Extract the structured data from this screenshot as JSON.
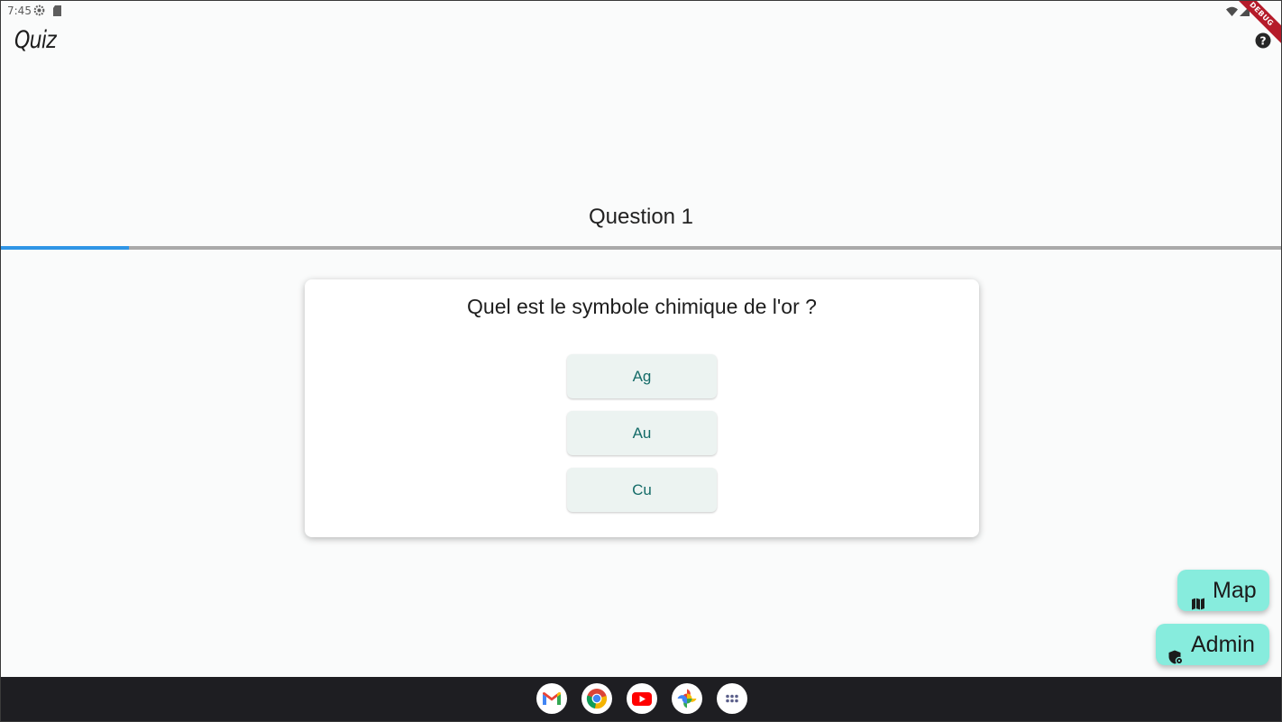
{
  "status_bar": {
    "time": "7:45",
    "left_icons": [
      "settings-gear-icon",
      "sd-card-icon"
    ],
    "right_icons": [
      "wifi-icon",
      "signal-icon"
    ],
    "debug_label": "DEBUG"
  },
  "app_bar": {
    "title": "Quiz",
    "help_icon": "help-circle-icon"
  },
  "quiz": {
    "question_label": "Question 1",
    "progress": 0.1,
    "question_text": "Quel est le symbole chimique de l'or ?",
    "answers": [
      "Ag",
      "Au",
      "Cu"
    ]
  },
  "fabs": {
    "map_label": "Map",
    "map_icon": "map-icon",
    "admin_label": "Admin",
    "admin_icon": "admin-shield-icon"
  },
  "taskbar": {
    "apps": [
      "gmail-icon",
      "chrome-icon",
      "youtube-icon",
      "photos-icon",
      "app-drawer-icon"
    ]
  },
  "colors": {
    "accent_progress": "#2f95e6",
    "fab_background": "#87ecdd",
    "answer_text": "#146b68",
    "answer_background": "#ecf3f1",
    "debug_banner": "#b51b2a"
  }
}
